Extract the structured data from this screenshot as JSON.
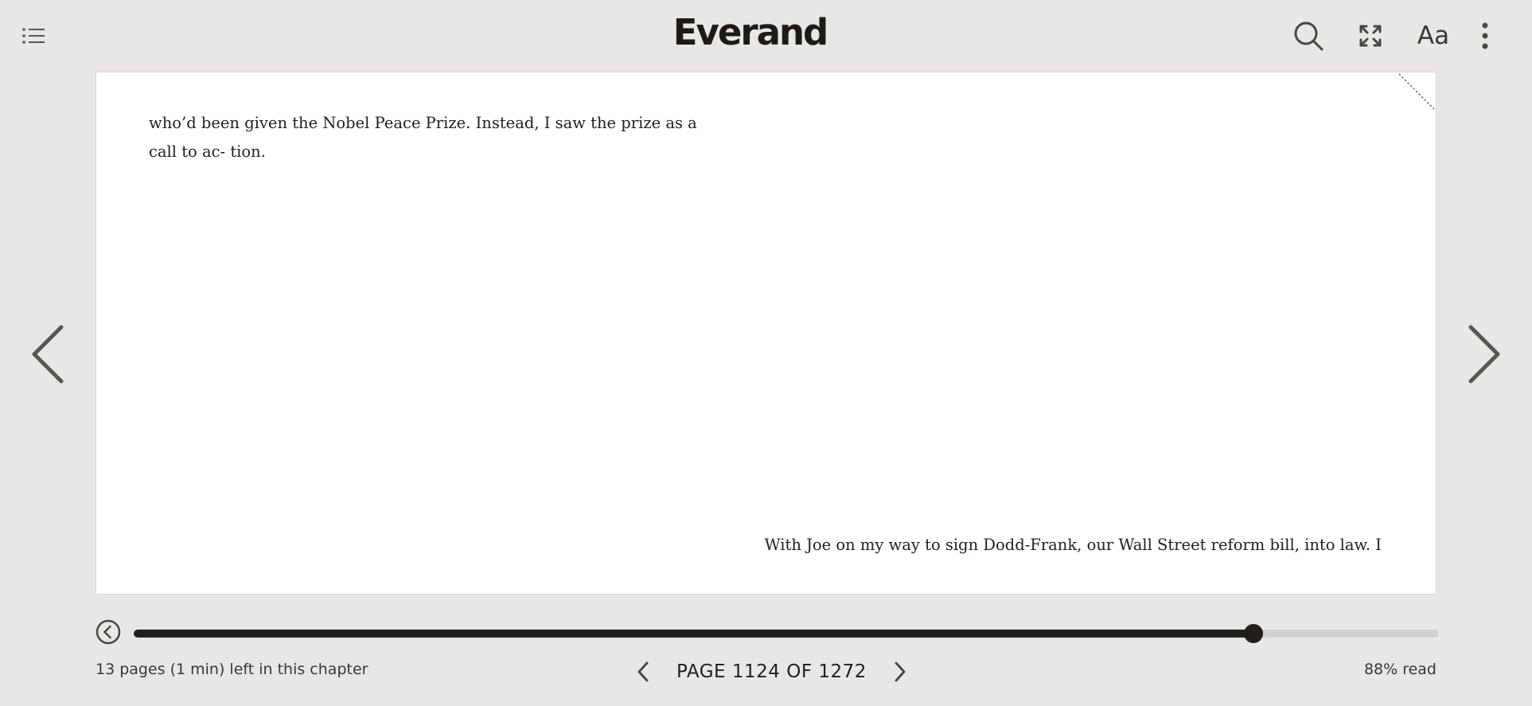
{
  "header": {
    "logo": "Everand",
    "icons": {
      "toc": "list-icon",
      "search": "search-icon",
      "fullscreen": "expand-icon",
      "font_settings_label": "Aa",
      "more": "more-vertical-icon"
    }
  },
  "reader": {
    "left_page_text": "who’d been given the Nobel Peace Prize. Instead, I saw the prize as a call to ac- tion.",
    "right_page_text": "With Joe on my way to sign Dodd-Frank, our Wall Street reform bill, into law. I"
  },
  "navigation": {
    "prev_icon": "chevron-left-icon",
    "next_icon": "chevron-right-icon"
  },
  "footer": {
    "progress_fraction": 0.858,
    "chapter_remaining": "13 pages (1 min) left in this chapter",
    "page_label": "PAGE 1124 OF 1272",
    "percent_read": "88% read"
  },
  "colors": {
    "background": "#e8e7e5",
    "page": "#ffffff",
    "accent": "#221e1b",
    "track": "#d4d2ce"
  }
}
